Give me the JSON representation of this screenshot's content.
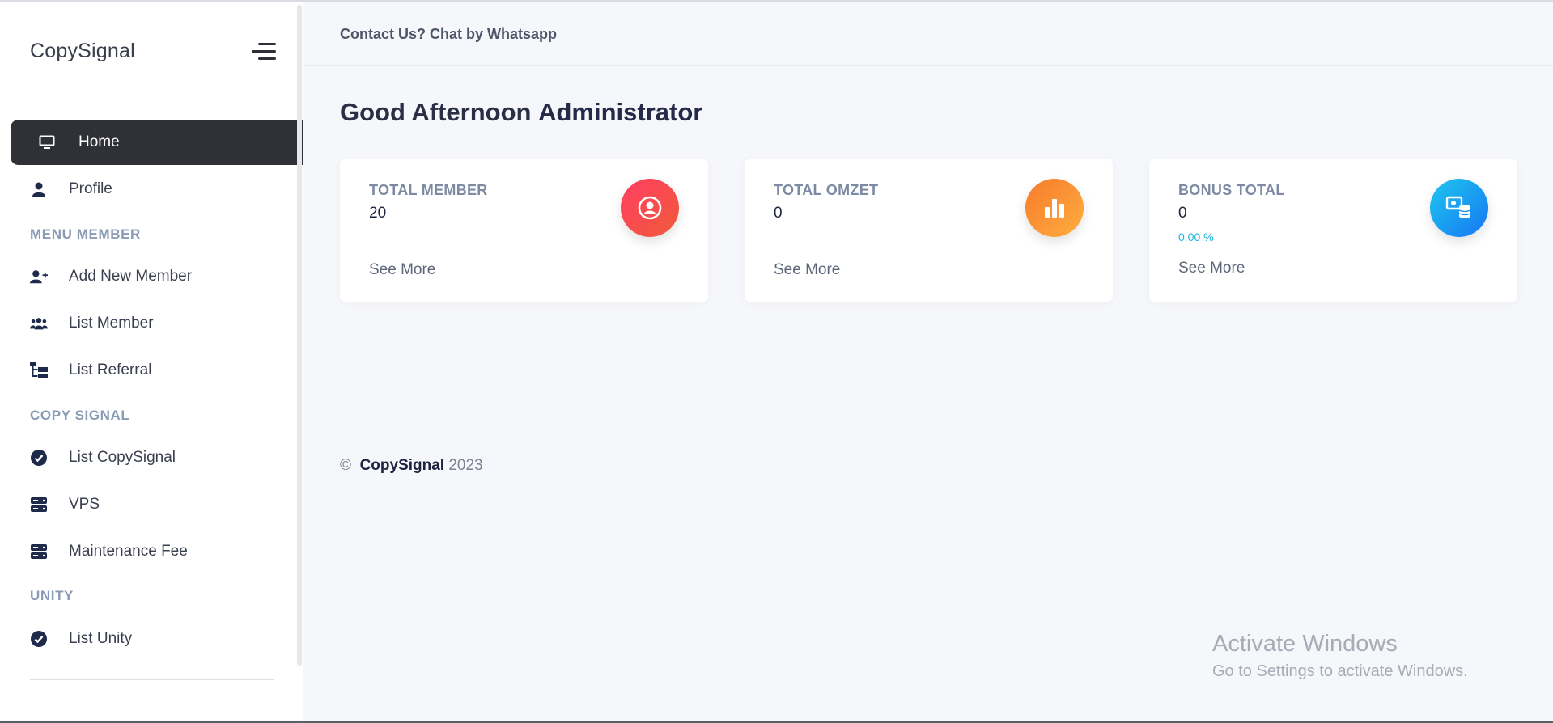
{
  "brand": "CopySignal",
  "topbar": {
    "contact_link": "Contact Us? Chat by Whatsapp"
  },
  "sidebar": {
    "items": [
      {
        "label": "Home",
        "icon": "monitor-icon"
      },
      {
        "label": "Profile",
        "icon": "user-icon"
      },
      {
        "label": "Add New Member",
        "icon": "user-plus-icon"
      },
      {
        "label": "List Member",
        "icon": "users-icon"
      },
      {
        "label": "List Referral",
        "icon": "sitemap-icon"
      },
      {
        "label": "List CopySignal",
        "icon": "check-circle-icon"
      },
      {
        "label": "VPS",
        "icon": "server-icon"
      },
      {
        "label": "Maintenance Fee",
        "icon": "server-icon"
      },
      {
        "label": "List Unity",
        "icon": "check-circle-icon"
      }
    ],
    "sections": [
      "MENU MEMBER",
      "COPY SIGNAL",
      "UNITY"
    ]
  },
  "greeting": {
    "prefix": "Good Afternoon",
    "name": "Administrator"
  },
  "cards": [
    {
      "title": "TOTAL MEMBER",
      "value": "20",
      "more": "See More",
      "icon": "user-circle-icon",
      "color": "#f2445a"
    },
    {
      "title": "TOTAL OMZET",
      "value": "0",
      "more": "See More",
      "icon": "bar-chart-icon",
      "color": "#fb9235"
    },
    {
      "title": "BONUS TOTAL",
      "value": "0",
      "percent": "0.00 %",
      "more": "See More",
      "icon": "database-icon",
      "color": "#1aa0f0"
    }
  ],
  "footer": {
    "symbol": "©",
    "brand": "CopySignal",
    "year": "2023"
  },
  "watermark": {
    "title": "Activate Windows",
    "subtitle": "Go to Settings to activate Windows."
  },
  "colors": {
    "active_nav_bg": "#2f3136",
    "page_bg": "#f6f7fb",
    "nav_icon": "#1e2a4a"
  }
}
